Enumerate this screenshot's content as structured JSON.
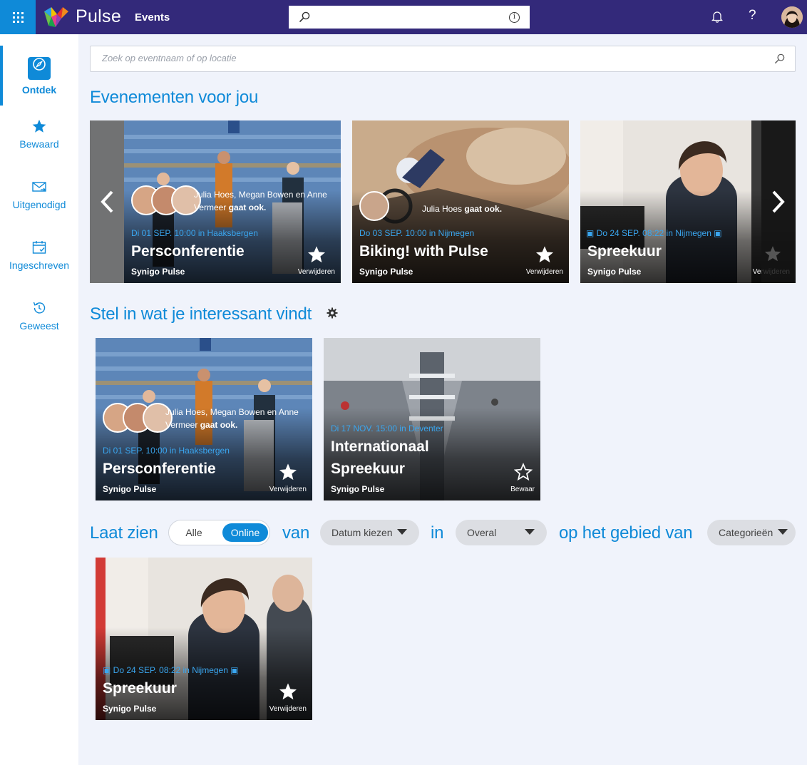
{
  "app": {
    "brand": "Pulse",
    "section": "Events"
  },
  "nav": {
    "items": [
      {
        "label": "Ontdek"
      },
      {
        "label": "Bewaard"
      },
      {
        "label": "Uitgenodigd"
      },
      {
        "label": "Ingeschreven"
      },
      {
        "label": "Geweest"
      }
    ]
  },
  "search": {
    "placeholder": "Zoek op eventnaam of op locatie"
  },
  "sections": {
    "for_you": "Evenementen voor jou",
    "interests": "Stel in wat je interessant vindt",
    "show": "Laat zien",
    "of": "van",
    "in": "in",
    "area": "op het gebied van"
  },
  "cards_for_you": [
    {
      "date": "Di 01 SEP. 10:00 in Haaksbergen",
      "title": "Persconferentie",
      "org": "Synigo Pulse",
      "action": "Verwijderen",
      "going_names": "Julia Hoes, Megan Bowen en Anne Vermeer",
      "going_suffix": "gaat ook."
    },
    {
      "date": "Do 03 SEP. 10:00 in Nijmegen",
      "title": "Biking! with Pulse",
      "org": "Synigo Pulse",
      "action": "Verwijderen",
      "going_names": "Julia Hoes",
      "going_suffix": "gaat ook."
    },
    {
      "date": "Do 24 SEP. 08:22 in Nijmegen",
      "title": "Spreekuur",
      "org": "Synigo Pulse",
      "action": "Verwijderen"
    }
  ],
  "cards_interests": [
    {
      "date": "Di 01 SEP. 10:00 in Haaksbergen",
      "title": "Persconferentie",
      "org": "Synigo Pulse",
      "action": "Verwijderen",
      "going_names": "Julia Hoes, Megan Bowen en Anne Vermeer",
      "going_suffix": "gaat ook."
    },
    {
      "date": "Di 17 NOV. 15:00 in Deventer",
      "title_line1": "Internationaal",
      "title_line2": "Spreekuur",
      "org": "Synigo Pulse",
      "action": "Bewaar"
    }
  ],
  "cards_filtered": [
    {
      "date": "Do 24 SEP. 08:22 in Nijmegen",
      "title": "Spreekuur",
      "org": "Synigo Pulse",
      "action": "Verwijderen"
    }
  ],
  "filters": {
    "toggle_all": "Alle",
    "toggle_online": "Online",
    "toggle_selected": "Online",
    "date": "Datum kiezen",
    "location": "Overal",
    "category": "Categorieën"
  },
  "colors": {
    "accent": "#0f8ad8",
    "topbar": "#33297a",
    "background": "#f0f3fb",
    "date_text": "#3aa6ef"
  }
}
